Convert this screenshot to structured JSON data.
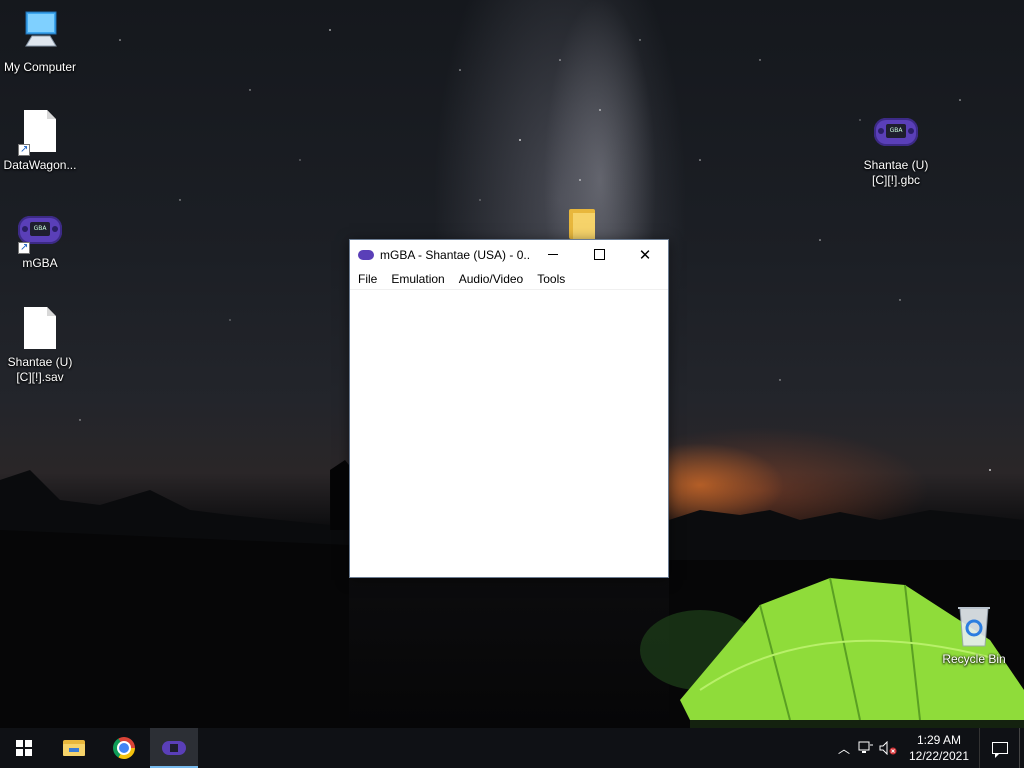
{
  "desktop": {
    "icons": [
      {
        "label": "My Computer"
      },
      {
        "label": "DataWagon..."
      },
      {
        "label": "mGBA"
      },
      {
        "label": "Shantae (U) [C][!].sav"
      },
      {
        "label": "Shantae (U) [C][!].gbc"
      },
      {
        "label": "Recycle Bin"
      }
    ]
  },
  "window": {
    "title": "mGBA - Shantae (USA) - 0....",
    "menu": [
      "File",
      "Emulation",
      "Audio/Video",
      "Tools"
    ],
    "controls": {
      "minimize": "—",
      "maximize": "□",
      "close": "✕"
    }
  },
  "taskbar": {
    "clock_time": "1:29 AM",
    "clock_date": "12/22/2021",
    "tray_chevron": "︿"
  },
  "colors": {
    "taskbar": "#0f1115",
    "accent": "#76b9ed",
    "gba_purple": "#5a3fb8",
    "tent_green": "#8fdc3a"
  }
}
